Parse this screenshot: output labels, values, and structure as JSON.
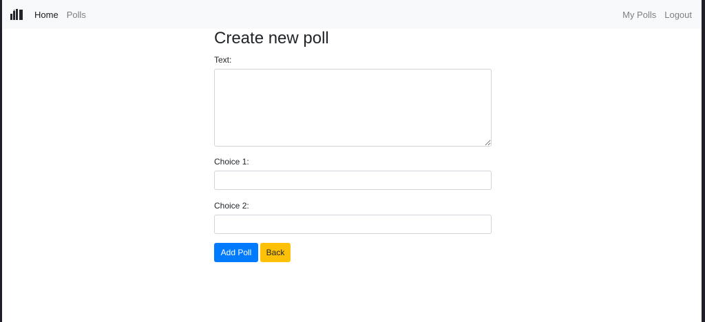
{
  "navbar": {
    "brand_icon": "poll-bars-icon",
    "left_links": [
      {
        "label": "Home",
        "active": true
      },
      {
        "label": "Polls",
        "active": false
      }
    ],
    "right_links": [
      {
        "label": "My Polls"
      },
      {
        "label": "Logout"
      }
    ]
  },
  "form": {
    "title": "Create new poll",
    "text_label": "Text:",
    "text_value": "",
    "choice1_label": "Choice 1:",
    "choice1_value": "",
    "choice2_label": "Choice 2:",
    "choice2_value": "",
    "submit_label": "Add Poll",
    "back_label": "Back"
  },
  "colors": {
    "primary": "#007bff",
    "warning": "#ffc107",
    "navbar_bg": "#f8f9fa",
    "outer_bg": "#1f1f27"
  }
}
